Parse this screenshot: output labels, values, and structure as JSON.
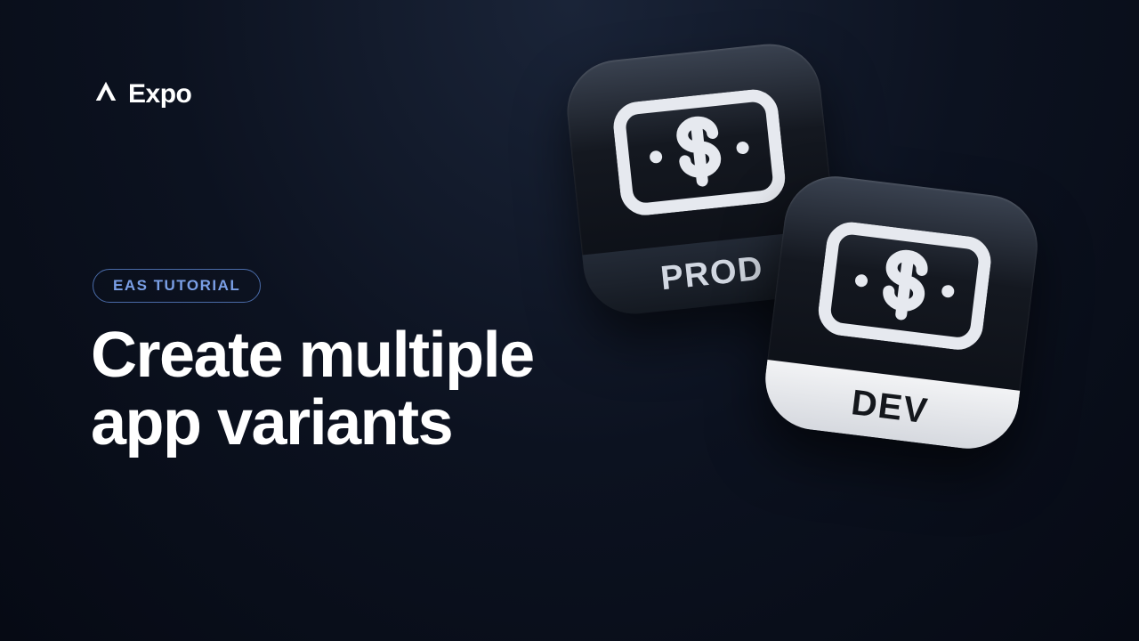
{
  "brand": {
    "name": "Expo"
  },
  "badge": {
    "label": "EAS TUTORIAL"
  },
  "headline": {
    "line1": "Create multiple",
    "line2": "app variants"
  },
  "icons": {
    "prod_label": "PROD",
    "dev_label": "DEV"
  }
}
